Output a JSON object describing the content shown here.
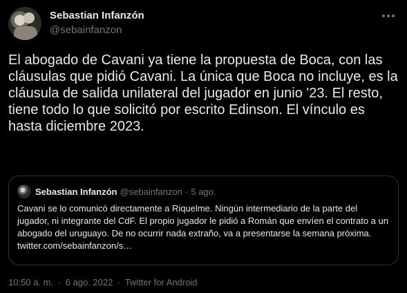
{
  "tweet": {
    "author_name": "Sebastian Infanzón",
    "author_handle": "@sebainfanzon",
    "text": "El abogado de Cavani ya tiene la propuesta de Boca, con las cláusulas que pidió Cavani. La única que Boca no incluye, es la cláusula de salida unilateral del jugador en junio '23. El resto, tiene todo lo que solicitó por escrito Edinson. El vínculo es hasta diciembre 2023.",
    "time": "10:50 a. m.",
    "separator": "·",
    "date": "6 ago. 2022",
    "source": "Twitter for Android",
    "more_icon": "more-horizontal-icon"
  },
  "quote": {
    "author_name": "Sebastian Infanzón",
    "author_handle": "@sebainfanzon",
    "separator": "·",
    "date": "5 ago.",
    "text": "Cavani se lo comunicó directamente a Riquelme. Ningún intermediario de la parte del jugador, ni integrante del CdF. El propio jugador le pidió a Román que envíen el contrato a un abogado del uruguayo. De no ocurrir nada extraño, va a presentarse la semana próxima. twitter.com/sebainfanzon/s…"
  },
  "colors": {
    "background": "#000000",
    "primary_text": "#e7e9ea",
    "secondary_text": "#71767b",
    "border": "#2f3336"
  }
}
